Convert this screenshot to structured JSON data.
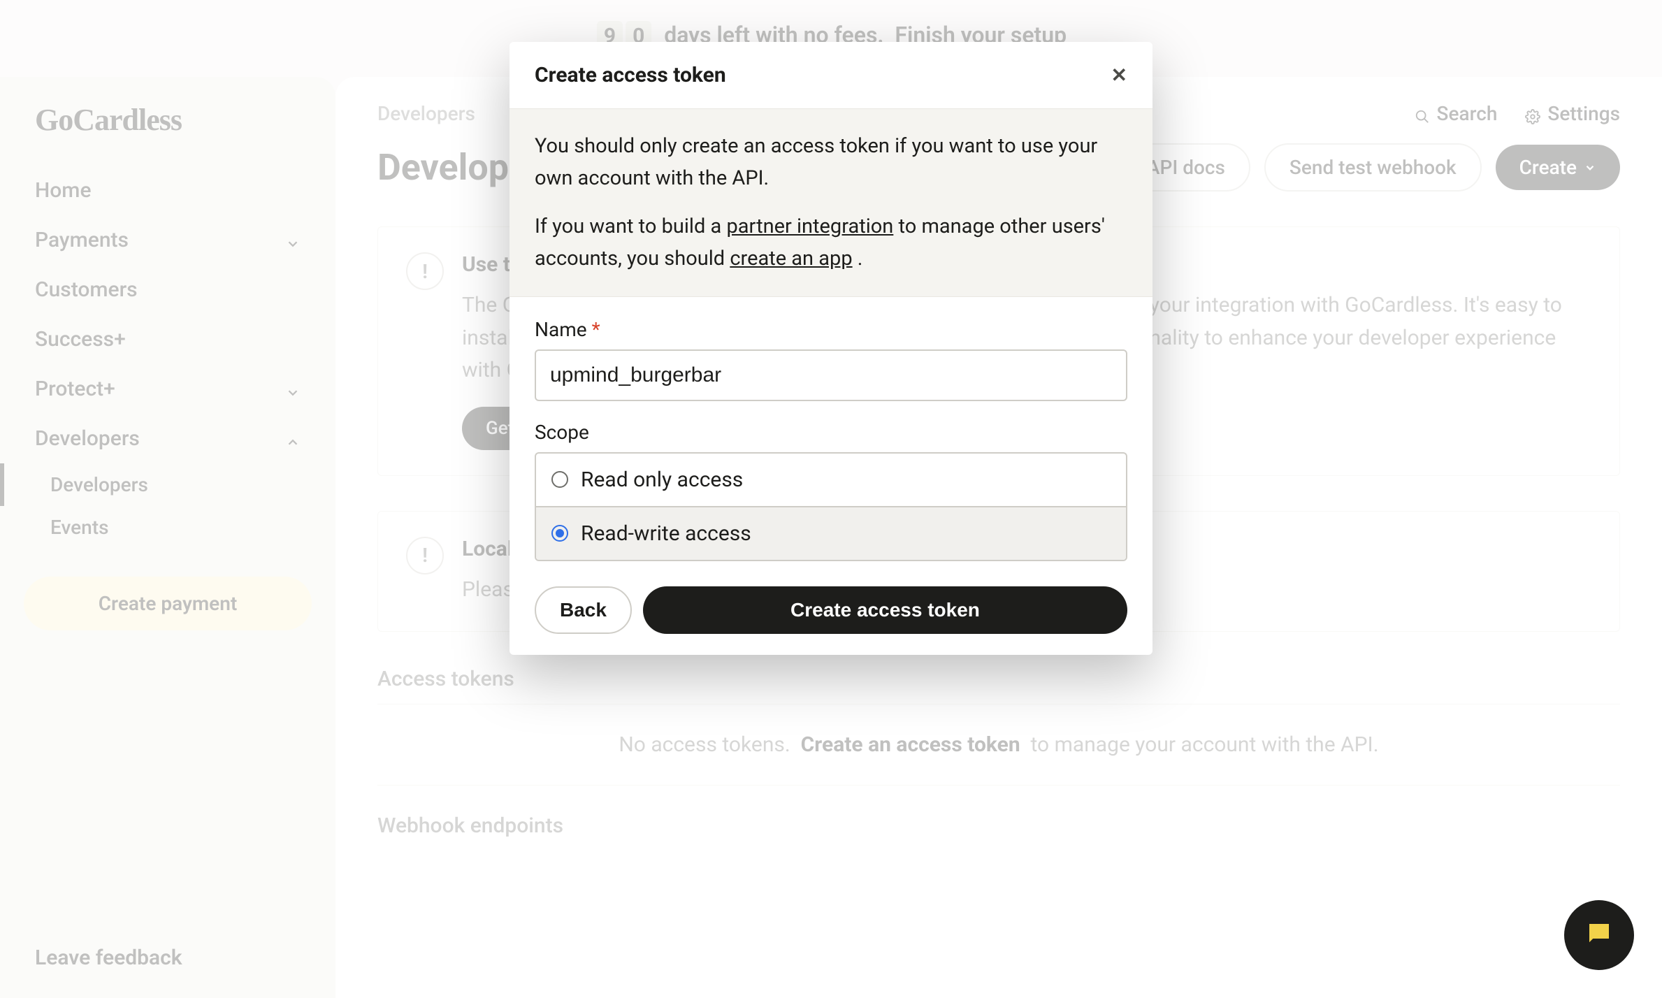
{
  "banner": {
    "digit1": "9",
    "digit2": "0",
    "text": "days left with no fees.",
    "cta": "Finish your setup"
  },
  "brand": "GoCardless",
  "sidebar": {
    "home": "Home",
    "payments": "Payments",
    "customers": "Customers",
    "success": "Success+",
    "protect": "Protect+",
    "developers": "Developers",
    "sub_developers": "Developers",
    "sub_events": "Events",
    "create_payment": "Create payment",
    "leave_feedback": "Leave feedback"
  },
  "header": {
    "breadcrumb": "Developers",
    "search": "Search",
    "settings": "Settings",
    "title": "Developers",
    "api_docs": "API docs",
    "send_webhook": "Send test webhook",
    "create": "Create"
  },
  "card_cli": {
    "title": "Use the GC CLI",
    "body": "The GoCardless CLI is a developer tool to help you build, test and manage your integration with GoCardless. It's easy to install, works on macOS, Windows and Linux, and offers a range of functionality to enhance your developer experience with GoCardless.",
    "cta": "Get the CLI"
  },
  "card_local": {
    "title": "Local webhook testing",
    "body": "Please install and authorise the CLI using the instructions above."
  },
  "tokens": {
    "label": "Access tokens",
    "empty_pre": "No access tokens.",
    "empty_link": "Create an access token",
    "empty_post": "to manage your account with the API."
  },
  "webhooks_label": "Webhook endpoints",
  "modal": {
    "title": "Create access token",
    "p1": "You should only create an access token if you want to use your own account with the API.",
    "p2_a": "If you want to build a ",
    "p2_link1": "partner integration",
    "p2_b": " to manage other users' accounts, you should ",
    "p2_link2": "create an app",
    "p2_c": " .",
    "name_label": "Name",
    "name_value": "upmind_burgerbar",
    "scope_label": "Scope",
    "scope_read": "Read only access",
    "scope_write": "Read-write access",
    "back": "Back",
    "submit": "Create access token"
  }
}
